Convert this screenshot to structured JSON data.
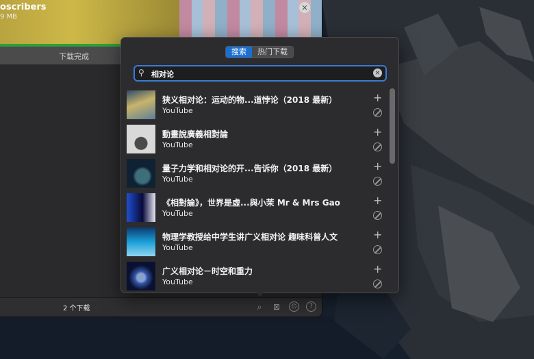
{
  "background_window": {
    "title": "oscribers",
    "size": "9 MB",
    "status": "下载完成",
    "download_count": "2 个下载"
  },
  "popover": {
    "tabs": [
      {
        "label": "搜索",
        "active": true
      },
      {
        "label": "热门下载",
        "active": false
      }
    ],
    "search": {
      "value": "相对论",
      "placeholder": ""
    },
    "results": [
      {
        "title": "狭义相对论：运动的物...道悖论（2018 最新）",
        "source": "YouTube",
        "thumb_colors": [
          "#2f4a6a",
          "#c9b46a",
          "#5d7f9a"
        ]
      },
      {
        "title": "動畫說廣義相對論",
        "source": "YouTube",
        "thumb_colors": [
          "#d9d9d9",
          "#7a7a7a",
          "#bcbcbc"
        ]
      },
      {
        "title": "量子力学和相对论的开...告诉你（2018 最新）",
        "source": "YouTube",
        "thumb_colors": [
          "#0e2233",
          "#3e6e7a",
          "#b01c1c"
        ]
      },
      {
        "title": "《相對論》，世界是虛...與小茉 Mr & Mrs Gao",
        "source": "YouTube",
        "thumb_colors": [
          "#0a0a3a",
          "#1e4fd1",
          "#e6e6f5"
        ]
      },
      {
        "title": "物理学教授给中学生讲广义相对论 趣味科普人文",
        "source": "YouTube",
        "thumb_colors": [
          "#1a9fd8",
          "#0d3a6e",
          "#8fd6f0"
        ]
      },
      {
        "title": "广义相对论－时空和重力",
        "source": "YouTube",
        "thumb_colors": [
          "#0a1030",
          "#3355aa",
          "#88a0cc"
        ]
      }
    ]
  },
  "colors": {
    "accent": "#1b6fd1",
    "progress": "#2f9e3a"
  }
}
